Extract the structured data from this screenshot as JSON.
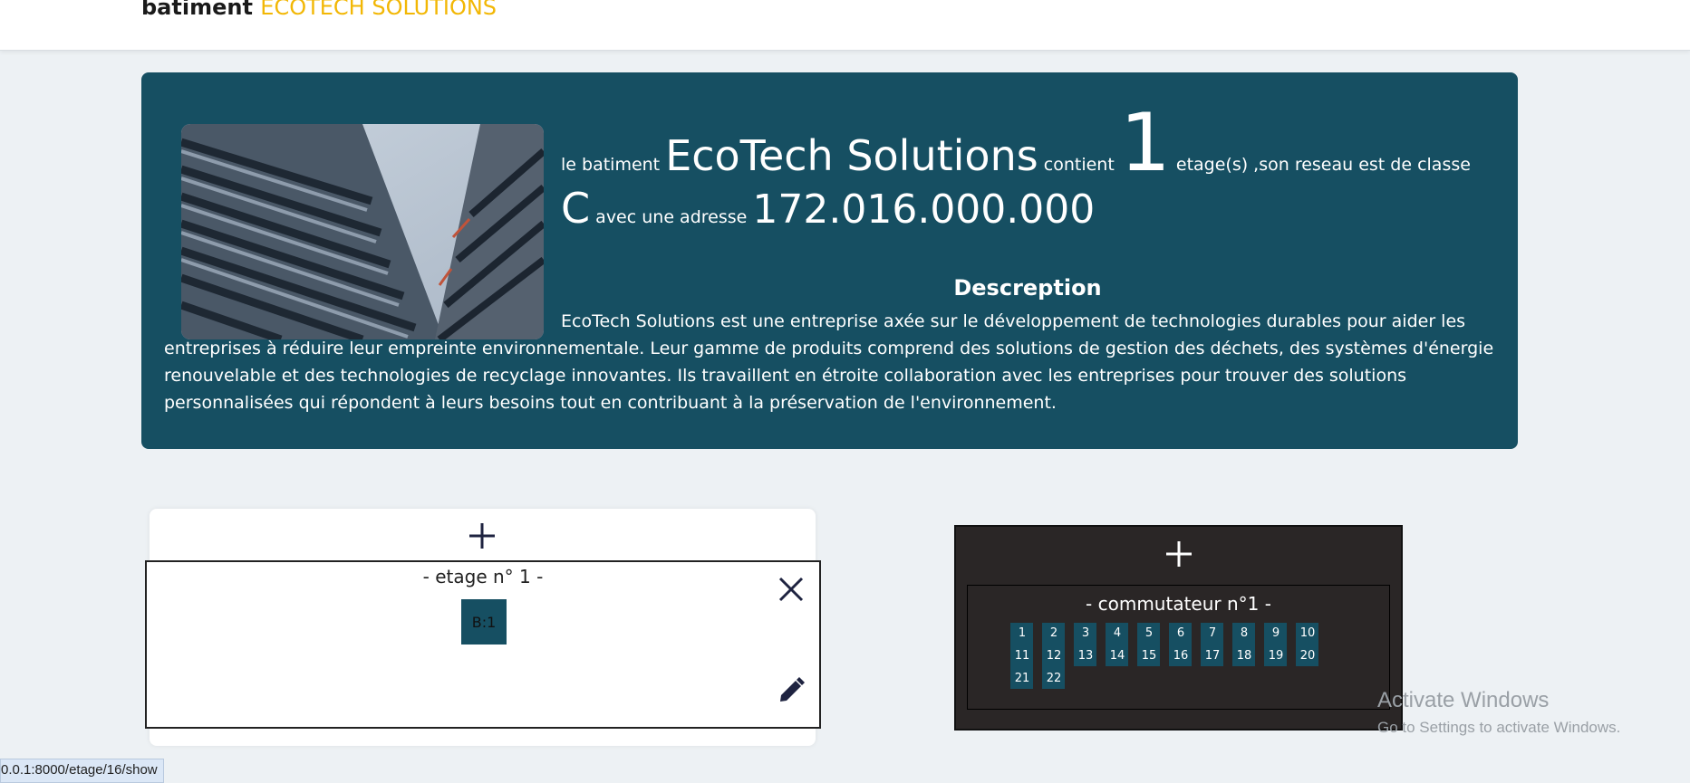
{
  "header": {
    "prefix": "batiment",
    "name": "ECOTECH SOLUTIONS",
    "accent_color": "#f2b705"
  },
  "info": {
    "intro": "le batiment",
    "name": "EcoTech Solutions",
    "contient": "contient",
    "floors": "1",
    "mid": "etage(s) ,son reseau est de classe",
    "net_class": "C",
    "avec": "avec une adresse",
    "address": "172.016.000.000",
    "desc_title": "Descreption",
    "description": "EcoTech Solutions est une entreprise axée sur le développement de technologies durables pour aider les entreprises à réduire leur empreinte environnementale. Leur gamme de produits comprend des solutions de gestion des déchets, des systèmes d'énergie renouvelable et des technologies de recyclage innovantes. Ils travaillent en étroite collaboration avec les entreprises pour trouver des solutions personnalisées qui répondent à leurs besoins tout en contribuant à la préservation de l'environnement.",
    "card_color": "#164f62"
  },
  "floor": {
    "title": "- etage n° 1 -",
    "building_chip": "B:1"
  },
  "switch": {
    "title": "- commutateur n°1 -",
    "ports": [
      "1",
      "2",
      "3",
      "4",
      "5",
      "6",
      "7",
      "8",
      "9",
      "10",
      "11",
      "12",
      "13",
      "14",
      "15",
      "16",
      "17",
      "18",
      "19",
      "20",
      "21",
      "22"
    ]
  },
  "icons": {
    "add": "plus-icon",
    "close": "close-icon",
    "edit": "pencil-icon"
  },
  "watermark": {
    "line1": "Activate Windows",
    "line2": "Go to Settings to activate Windows."
  },
  "status_bar": {
    "url": "0.0.1:8000/etage/16/show"
  }
}
